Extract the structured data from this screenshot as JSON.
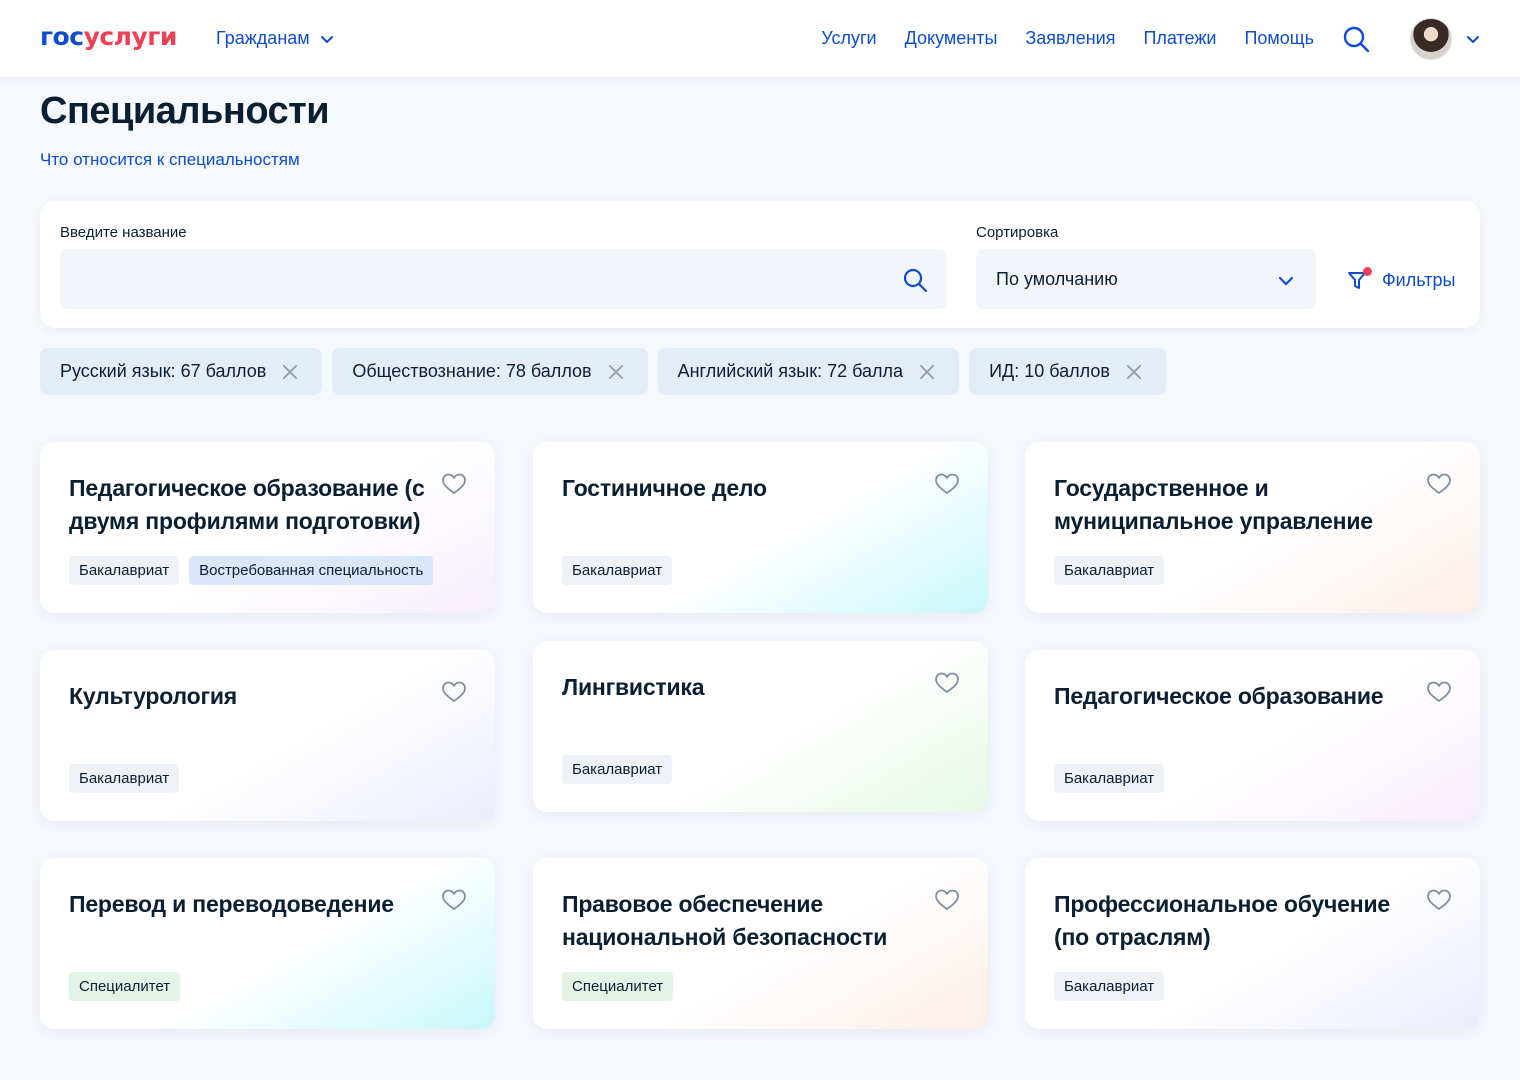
{
  "header": {
    "logo_part1": "гос",
    "logo_part2": "услуги",
    "audience": "Гражданам",
    "nav": [
      "Услуги",
      "Документы",
      "Заявления",
      "Платежи",
      "Помощь"
    ]
  },
  "page": {
    "title": "Специальности",
    "about_link": "Что относится к специальностям"
  },
  "search": {
    "label": "Введите название",
    "value": "",
    "placeholder": ""
  },
  "sort": {
    "label": "Сортировка",
    "value": "По умолчанию"
  },
  "filters": {
    "label": "Фильтры",
    "active": true
  },
  "chips": [
    "Русский язык: 67 баллов",
    "Обществознание: 78 баллов",
    "Английский язык: 72 балла",
    "ИД: 10 баллов"
  ],
  "cards": [
    {
      "title": "Педагогическое образование (с двумя профилями подготовки)",
      "tags": [
        "Бакалавриат",
        "Востребованная специальность"
      ]
    },
    {
      "title": "Гостиничное дело",
      "tags": [
        "Бакалавриат"
      ]
    },
    {
      "title": "Государственное и муниципальное управление",
      "tags": [
        "Бакалавриат"
      ]
    },
    {
      "title": "Культурология",
      "tags": [
        "Бакалавриат"
      ]
    },
    {
      "title": "Лингвистика",
      "tags": [
        "Бакалавриат"
      ]
    },
    {
      "title": "Педагогическое образование",
      "tags": [
        "Бакалавриат"
      ]
    },
    {
      "title": "Перевод и переводоведение",
      "tags": [
        "Специалитет"
      ]
    },
    {
      "title": "Правовое обеспечение национальной безопасности",
      "tags": [
        "Специалитет"
      ]
    },
    {
      "title": "Профессиональное обучение (по отраслям)",
      "tags": [
        "Бакалавриат"
      ]
    }
  ],
  "colors": {
    "accent": "#0d4cd3",
    "brand_red": "#ee3f58",
    "text": "#0b1f33",
    "background": "#f5f8fd"
  },
  "icons": {
    "search": "search-icon",
    "filter": "filter-icon",
    "favorite": "heart-icon",
    "remove": "close-icon",
    "dropdown": "chevron-down-icon"
  }
}
